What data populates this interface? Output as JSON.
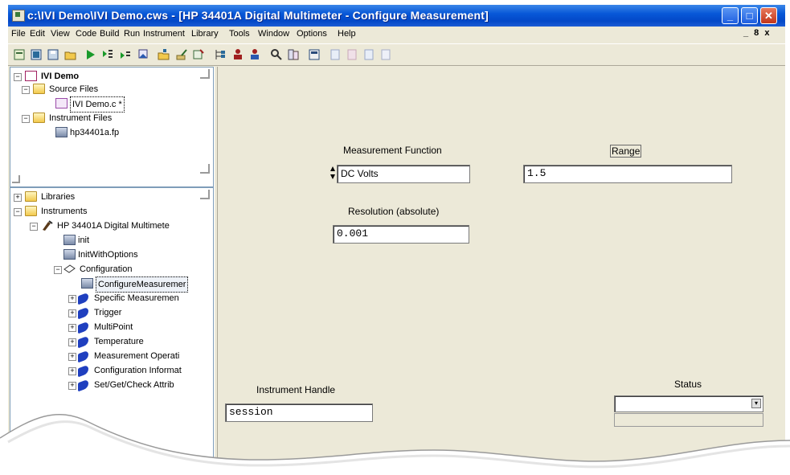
{
  "window": {
    "title": "c:\\IVI Demo\\IVI Demo.cws - [HP 34401A Digital Multimeter - Configure Measurement]"
  },
  "colors": {
    "titlebar": "#0858d8",
    "face": "#ece9d8",
    "close": "#c2361a",
    "book": "#1f3fbf"
  },
  "menu": [
    "File",
    "Edit",
    "View",
    "Code",
    "Build",
    "Run",
    "Instrument",
    "Library",
    "Tools",
    "Window",
    "Options",
    "Help"
  ],
  "mdi_controls": "_ 8 x",
  "toolbar": [
    "new-project-icon",
    "open-file-icon",
    "save-icon",
    "open-folder-icon",
    "run-icon",
    "step-into-icon",
    "step-over-icon",
    "step-out-icon",
    "open-icon",
    "edit-icon",
    "tags-icon",
    "tree-icon",
    "users-icon",
    "users-alt-icon",
    "find-icon",
    "diff-icon",
    "panel-icon",
    "doc-icon",
    "doc2-icon",
    "doc3-icon",
    "doc4-icon"
  ],
  "project": {
    "name": "IVI Demo",
    "source_folder": "Source Files",
    "source_file": "IVI Demo.c *",
    "instrument_folder": "Instrument Files",
    "instrument_file": "hp34401a.fp"
  },
  "tree": {
    "libraries": "Libraries",
    "instruments": "Instruments",
    "driver": "HP 34401A Digital Multimete",
    "init": "init",
    "init_options": "InitWithOptions",
    "configuration": "Configuration",
    "configure_measurement": "ConfigureMeasuremer",
    "items": [
      "Specific Measuremen",
      "Trigger",
      "MultiPoint",
      "Temperature",
      "Measurement Operati",
      "Configuration Informat",
      "Set/Get/Check Attrib"
    ]
  },
  "panel": {
    "measurement_function_label": "Measurement Function",
    "measurement_function_value": "DC Volts",
    "range_label": "Range",
    "range_value": "1.5",
    "resolution_label": "Resolution (absolute)",
    "resolution_value": "0.001",
    "handle_label": "Instrument Handle",
    "handle_value": "session",
    "status_label": "Status",
    "status_value": ""
  }
}
